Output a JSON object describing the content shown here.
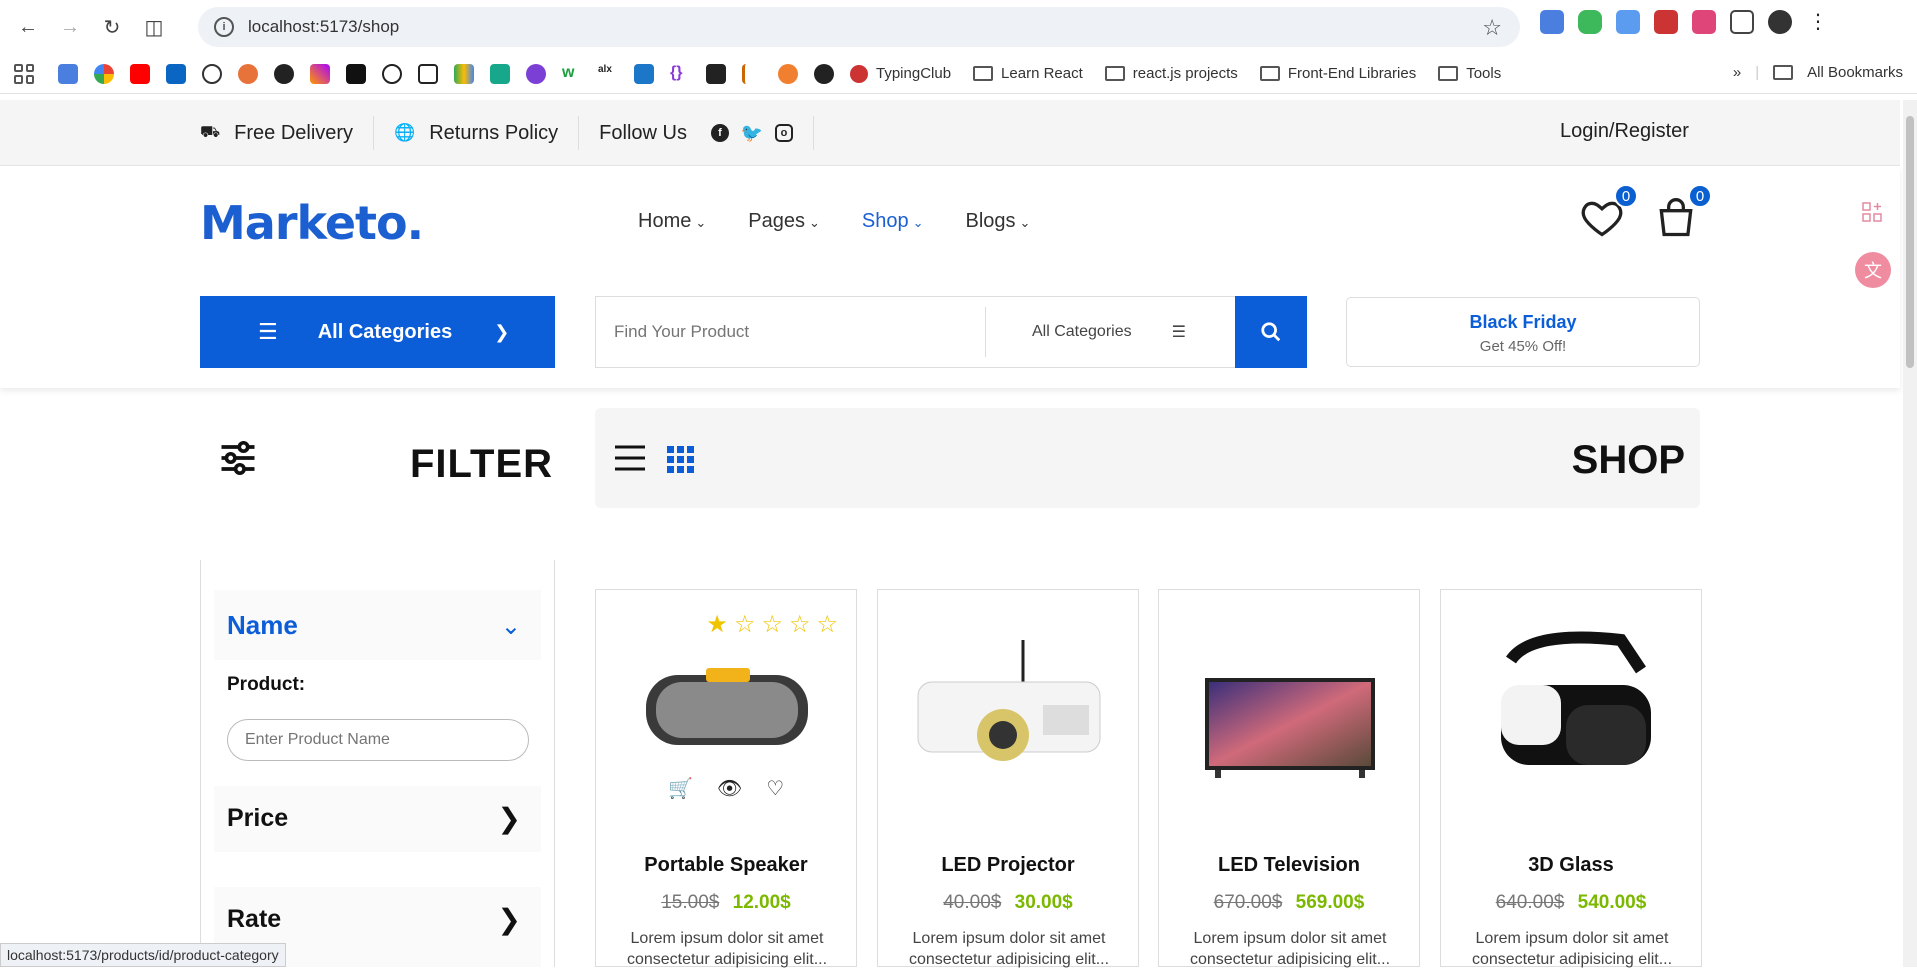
{
  "browser": {
    "url": "localhost:5173/shop",
    "bookmarks": [
      {
        "label": "TypingClub"
      },
      {
        "label": "Learn React"
      },
      {
        "label": "react.js projects"
      },
      {
        "label": "Front-End Libraries"
      },
      {
        "label": "Tools"
      }
    ],
    "all_bookmarks": "All Bookmarks",
    "status_url": "localhost:5173/products/id/product-category"
  },
  "topbar": {
    "delivery": "Free Delivery",
    "returns": "Returns Policy",
    "follow": "Follow Us",
    "login": "Login/Register"
  },
  "header": {
    "logo_part1": "Mark",
    "logo_part2": "eto.",
    "nav": [
      "Home",
      "Pages",
      "Shop",
      "Blogs"
    ],
    "active_nav": "Shop",
    "wishlist_count": "0",
    "cart_count": "0",
    "categories_button": "All Categories",
    "search_placeholder": "Find Your Product",
    "search_category": "All Categories",
    "promo_title": "Black Friday",
    "promo_sub": "Get 45% Off!"
  },
  "filter": {
    "title": "FILTER",
    "name_section": "Name",
    "product_label": "Product:",
    "product_placeholder": "Enter Product Name",
    "price_section": "Price",
    "rate_section": "Rate"
  },
  "shop": {
    "title": "SHOP"
  },
  "products": [
    {
      "name": "Portable Speaker",
      "old_price": "15.00$",
      "new_price": "12.00$",
      "desc": "Lorem ipsum dolor sit amet consectetur adipisicing elit...",
      "rating": 1
    },
    {
      "name": "LED Projector",
      "old_price": "40.00$",
      "new_price": "30.00$",
      "desc": "Lorem ipsum dolor sit amet consectetur adipisicing elit..."
    },
    {
      "name": "LED Television",
      "old_price": "670.00$",
      "new_price": "569.00$",
      "desc": "Lorem ipsum dolor sit amet consectetur adipisicing elit..."
    },
    {
      "name": "3D Glass",
      "old_price": "640.00$",
      "new_price": "540.00$",
      "desc": "Lorem ipsum dolor sit amet consectetur adipisicing elit..."
    }
  ],
  "colors": {
    "primary": "#0b5ed7",
    "price_green": "#7bb800",
    "star": "#f0c400"
  }
}
